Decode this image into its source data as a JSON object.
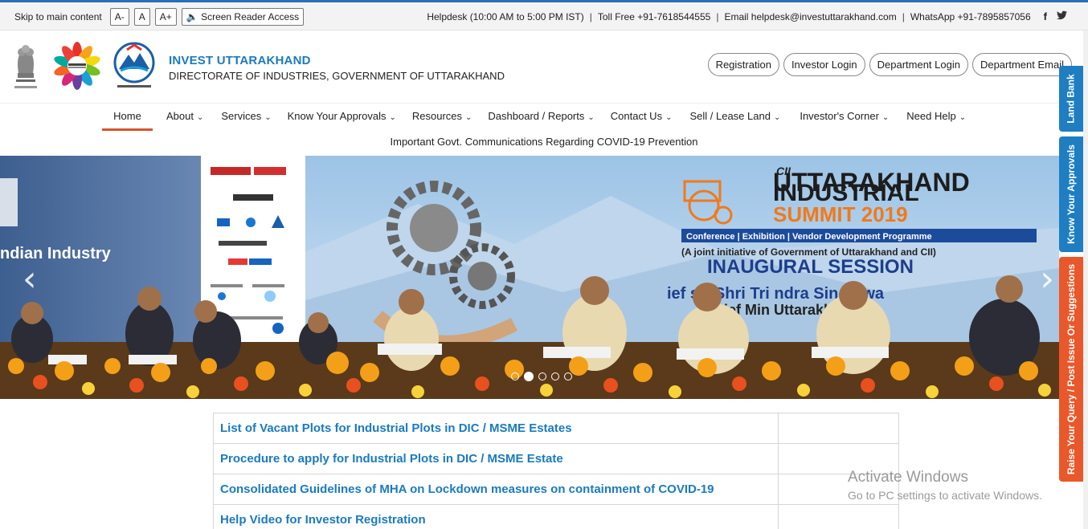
{
  "topbar": {
    "skip_link": "Skip to main content",
    "font_decrease": "A-",
    "font_normal": "A",
    "font_increase": "A+",
    "screen_reader": "Screen Reader Access",
    "helpdesk": "Helpdesk (10:00 AM to 5:00 PM IST)",
    "toll_free": "Toll Free +91-7618544555",
    "email": "Email helpdesk@investuttarakhand.com",
    "whatsapp": "WhatsApp +91-7895857056",
    "social_facebook": "f",
    "social_twitter": "🐦"
  },
  "header": {
    "title": "INVEST UTTARAKHAND",
    "subtitle": "DIRECTORATE OF INDUSTRIES, GOVERNMENT OF UTTARAKHAND",
    "buttons": [
      "Registration",
      "Investor Login",
      "Department Login",
      "Department Email"
    ]
  },
  "nav": {
    "items": [
      {
        "label": "Home"
      },
      {
        "label": "About"
      },
      {
        "label": "Services"
      },
      {
        "label": "Know Your Approvals"
      },
      {
        "label": "Resources"
      },
      {
        "label": "Dashboard / Reports"
      },
      {
        "label": "Contact Us"
      },
      {
        "label": "Sell / Lease Land"
      },
      {
        "label": "Investor's Corner"
      },
      {
        "label": "Need Help"
      }
    ],
    "announcement": "Important Govt. Communications Regarding COVID-19 Prevention"
  },
  "slider": {
    "prev": "‹",
    "next": "›",
    "slide_count": 5,
    "active_slide": 2,
    "banner": {
      "org": "CII",
      "line1": "UTTARAKHAND",
      "line2": "INDUSTRIAL",
      "line3": "SUMMIT 2019",
      "tagline": "Conference | Exhibition | Vendor Development Programme",
      "initiative": "(A joint initiative of Government of Uttarakhand and CII)",
      "session": "INAUGURAL SESSION",
      "guest": "ief   st: Shri Tri  ndra Singh  wa",
      "guest2": "bl  ief Min    Uttarakhan",
      "left_text": "ndian Industry"
    }
  },
  "links": [
    "List of Vacant Plots for Industrial Plots in DIC / MSME Estates",
    "Procedure to apply for Industrial Plots in DIC / MSME Estate",
    "Consolidated Guidelines of MHA on Lockdown measures on containment of COVID-19",
    "Help Video for Investor Registration"
  ],
  "side_tabs": {
    "land_bank": "Land Bank",
    "know_approvals": "Know Your Approvals",
    "raise_query": "Raise Your Query / Post Issue Or Suggestions"
  },
  "watermark": {
    "line1": "Activate Windows",
    "line2": "Go to PC settings to activate Windows."
  },
  "colors": {
    "brand_blue": "#1a7bbf",
    "accent_orange": "#e9582a",
    "tab_blue": "#1f7ec1"
  }
}
